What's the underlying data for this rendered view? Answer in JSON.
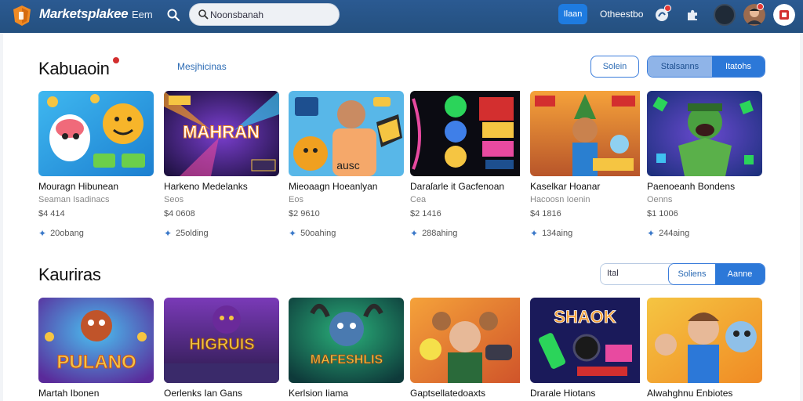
{
  "header": {
    "brand": "Marketsplakee",
    "nav_link": "Eem",
    "search_value": "Noonsbanah",
    "button_label": "Ilaan",
    "text_link": "Otheestbo"
  },
  "section1": {
    "title": "Kabuaoin",
    "sub_link": "Mesjhicinas",
    "filter_button": "Solein",
    "segment": [
      "Stalsanns",
      "Itatohs"
    ]
  },
  "section2": {
    "title": "Kauriras",
    "filter_input": "Ital",
    "segment": [
      "Soliens",
      "Aanne"
    ]
  },
  "row1": [
    {
      "title": "Mouragn Hibunean",
      "developer": "Seaman Isadinacs",
      "price": "$4 414",
      "rating": "20obang",
      "thumb_text": ""
    },
    {
      "title": "Harkeno Medelanks",
      "developer": "Seos",
      "price": "$4 0608",
      "rating": "25olding",
      "thumb_text": "MAHRAN"
    },
    {
      "title": "Mieoaagn Hoeanlyan",
      "developer": "Eos",
      "price": "$2 9610",
      "rating": "50oahing",
      "thumb_text": "ausc"
    },
    {
      "title": "Daraſarle it Gacfenoan",
      "developer": "Cea",
      "price": "$2 1416",
      "rating": "288ahing",
      "thumb_text": ""
    },
    {
      "title": "Kaselkar Hoanar",
      "developer": "Hacoosn Ioenin",
      "price": "$4 1816",
      "rating": "134aing",
      "thumb_text": ""
    },
    {
      "title": "Paenoeanh Bondens",
      "developer": "Oenns",
      "price": "$1 1006",
      "rating": "244aing",
      "thumb_text": ""
    }
  ],
  "row2": [
    {
      "title": "Martah Ibonen",
      "thumb_text": "PULANO"
    },
    {
      "title": "Oerlenks Ian Gans",
      "thumb_text": "HIGRUIS"
    },
    {
      "title": "Kerlsion Iiama",
      "thumb_text": "MAFESHLIS"
    },
    {
      "title": "Gaptsellatedoaxts",
      "thumb_text": ""
    },
    {
      "title": "Drarale Hiotans",
      "thumb_text": "SHAOK"
    },
    {
      "title": "Alwahghnu Enbiotes",
      "thumb_text": ""
    }
  ],
  "colors": {
    "topbar": "#2b5a92",
    "accent": "#1e7be0",
    "link": "#2d6cb5"
  }
}
